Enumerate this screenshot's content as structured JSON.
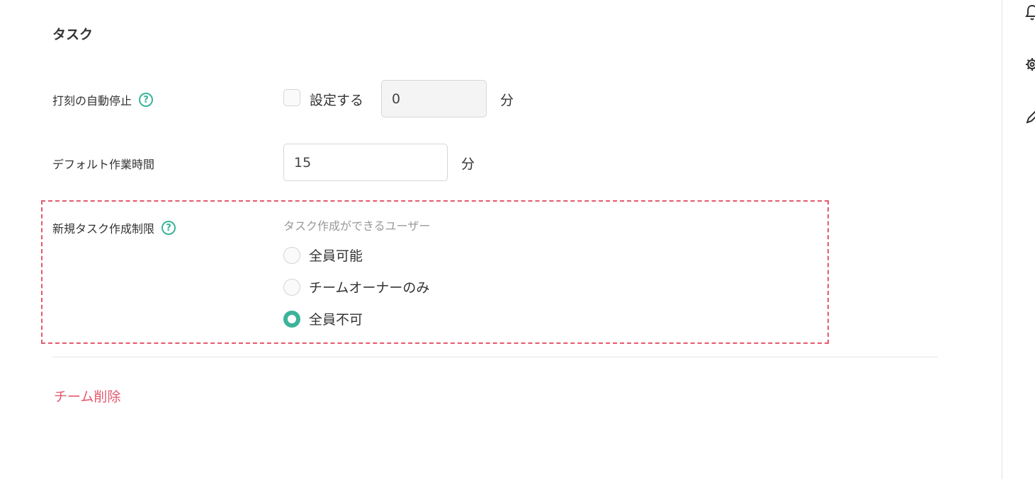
{
  "section": {
    "title": "タスク"
  },
  "auto_stop": {
    "label": "打刻の自動停止",
    "checkbox_label": "設定する",
    "value": "0",
    "unit": "分",
    "checked": false
  },
  "default_time": {
    "label": "デフォルト作業時間",
    "value": "15",
    "unit": "分"
  },
  "restriction": {
    "label": "新規タスク作成制限",
    "caption": "タスク作成ができるユーザー",
    "options": [
      {
        "label": "全員可能",
        "selected": false
      },
      {
        "label": "チームオーナーのみ",
        "selected": false
      },
      {
        "label": "全員不可",
        "selected": true
      }
    ]
  },
  "delete": {
    "label": "チーム削除"
  },
  "help_icon": {
    "glyph": "?"
  },
  "icons": [
    "bell-icon",
    "gear-icon",
    "pencil-icon"
  ],
  "colors": {
    "accent": "#3bb39a",
    "danger": "#e35a6e"
  }
}
